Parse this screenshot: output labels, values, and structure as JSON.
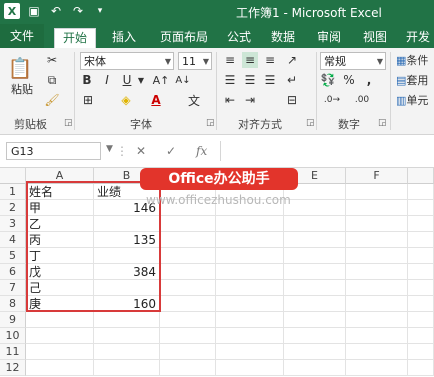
{
  "quick_access": [
    "save-icon",
    "undo-icon",
    "redo-icon"
  ],
  "window_title": "工作簿1 - Microsoft Excel",
  "tabs": [
    "文件",
    "开始",
    "插入",
    "页面布局",
    "公式",
    "数据",
    "审阅",
    "视图",
    "开发"
  ],
  "ribbon": {
    "paste_label": "粘贴",
    "clipboard_label": "剪贴板",
    "font_name": "宋体",
    "font_size": "11",
    "bold": "B",
    "italic": "I",
    "underline": "U",
    "font_group_label": "字体",
    "align_group_label": "对齐方式",
    "number_format": "常规",
    "percent": "%",
    "comma": ",",
    "number_group_label": "数字",
    "cond_label": "条件",
    "table_label": "套用",
    "cell_label": "单元"
  },
  "formula_bar": {
    "name_box": "G13",
    "cancel": "✕",
    "confirm": "✓",
    "fx": "fx"
  },
  "columns": [
    "A",
    "B",
    "C",
    "D",
    "E",
    "F"
  ],
  "rows": [
    {
      "num": "1",
      "a": "姓名",
      "b": "业绩"
    },
    {
      "num": "2",
      "a": "甲",
      "b": "146"
    },
    {
      "num": "3",
      "a": "乙",
      "b": ""
    },
    {
      "num": "4",
      "a": "丙",
      "b": "135"
    },
    {
      "num": "5",
      "a": "丁",
      "b": ""
    },
    {
      "num": "6",
      "a": "戊",
      "b": "384"
    },
    {
      "num": "7",
      "a": "己",
      "b": ""
    },
    {
      "num": "8",
      "a": "庚",
      "b": "160"
    },
    {
      "num": "9",
      "a": "",
      "b": ""
    },
    {
      "num": "10",
      "a": "",
      "b": ""
    },
    {
      "num": "11",
      "a": "",
      "b": ""
    },
    {
      "num": "12",
      "a": "",
      "b": ""
    }
  ],
  "watermark": {
    "badge": "Office办公助手",
    "url": "www.officezhushou.com"
  },
  "colors": {
    "excel_green": "#217346",
    "highlight_red": "#d83a3a"
  }
}
